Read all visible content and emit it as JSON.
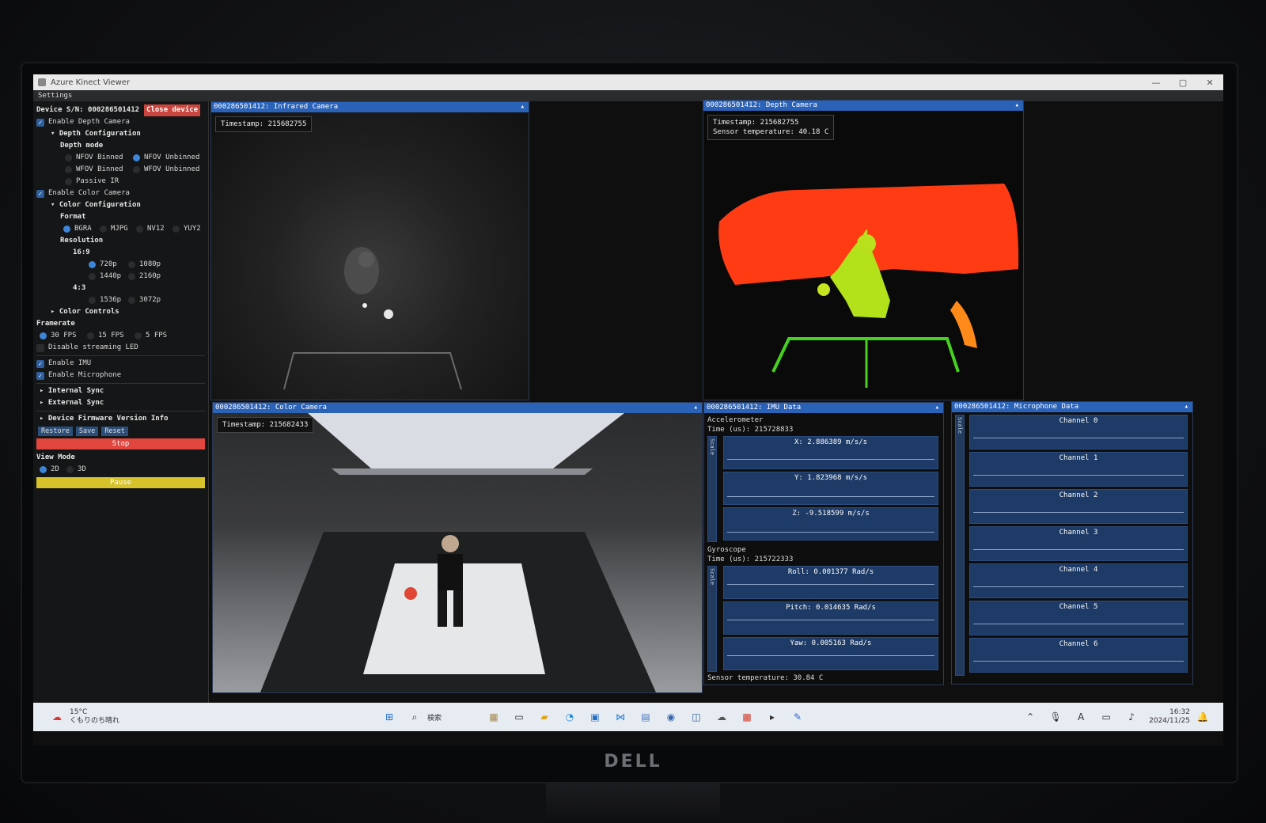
{
  "window": {
    "title": "Azure Kinect Viewer",
    "minimize": "—",
    "maximize": "▢",
    "close": "✕"
  },
  "menu": {
    "settings": "Settings"
  },
  "sidebar": {
    "device_label": "Device S/N: 000286501412",
    "close_device": "Close device",
    "enable_depth": "Enable Depth Camera",
    "depth_config": "Depth Configuration",
    "depth_mode": "Depth mode",
    "nfov_binned": "NFOV Binned",
    "nfov_unbinned": "NFOV Unbinned",
    "wfov_binned": "WFOV Binned",
    "wfov_unbinned": "WFOV Unbinned",
    "passive_ir": "Passive IR",
    "enable_color": "Enable Color Camera",
    "color_config": "Color Configuration",
    "format": "Format",
    "bgra": "BGRA",
    "mjpg": "MJPG",
    "nv12": "NV12",
    "yuy2": "YUY2",
    "resolution": "Resolution",
    "ratio_169": "16:9",
    "r720": "720p",
    "r1080": "1080p",
    "r1440": "1440p",
    "r2160": "2160p",
    "ratio_43": "4:3",
    "r1536": "1536p",
    "r3072": "3072p",
    "color_controls": "Color Controls",
    "framerate": "Framerate",
    "fps30": "30 FPS",
    "fps15": "15 FPS",
    "fps5": "5 FPS",
    "disable_led": "Disable streaming LED",
    "enable_imu": "Enable IMU",
    "enable_mic": "Enable Microphone",
    "internal_sync": "Internal Sync",
    "external_sync": "External Sync",
    "firmware": "Device Firmware Version Info",
    "restore": "Restore",
    "save": "Save",
    "reset": "Reset",
    "stop": "Stop",
    "view_mode": "View Mode",
    "mode2d": "2D",
    "mode3d": "3D",
    "pause": "Pause"
  },
  "colors": {
    "stop": "#e0453e",
    "pause": "#d7c22a",
    "accent": "#2a62b8"
  },
  "ir": {
    "title": "000286501412: Infrared Camera",
    "timestamp": "Timestamp: 215682755"
  },
  "depth": {
    "title": "000286501412: Depth Camera",
    "timestamp": "Timestamp: 215682755",
    "temperature": "Sensor temperature: 40.18 C"
  },
  "color": {
    "title": "000286501412: Color Camera",
    "timestamp": "Timestamp: 215682433"
  },
  "imu": {
    "title": "000286501412: IMU Data",
    "accel_label": "Accelerometer",
    "accel_time": "Time (us): 215728833",
    "x": "X:    2.886389 m/s/s",
    "y": "Y:    1.823968 m/s/s",
    "z": "Z:   -9.518599 m/s/s",
    "gyro_label": "Gyroscope",
    "gyro_time": "Time (us): 215722333",
    "roll": "Roll:    0.001377 Rad/s",
    "pitch": "Pitch:    0.014635 Rad/s",
    "yaw": "Yaw:    0.005163 Rad/s",
    "temperature": "Sensor temperature: 30.84 C",
    "scale": "Scale"
  },
  "mic": {
    "title": "000286501412: Microphone Data",
    "channels": [
      "Channel 0",
      "Channel 1",
      "Channel 2",
      "Channel 3",
      "Channel 4",
      "Channel 5",
      "Channel 6"
    ],
    "scale": "Scale"
  },
  "taskbar": {
    "weather_temp": "15°C",
    "weather_desc": "くもりのち晴れ",
    "search": "検索",
    "time": "16:32",
    "date": "2024/11/25"
  },
  "monitor": {
    "brand": "DELL"
  }
}
